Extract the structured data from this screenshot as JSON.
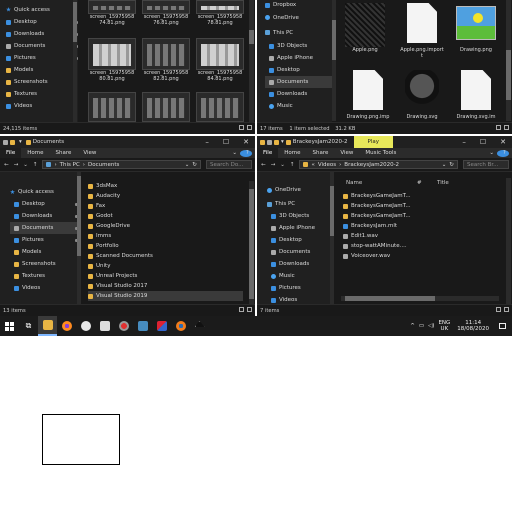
{
  "top_left": {
    "nav": [
      "Quick access",
      "Desktop",
      "Downloads",
      "Documents",
      "Pictures",
      "Models",
      "Screenshots",
      "Textures",
      "Videos"
    ],
    "thumbs": [
      [
        "screen_15975958",
        "74.81.png"
      ],
      [
        "screen_15975958",
        "76.81.png"
      ],
      [
        "screen_15975958",
        "78.81.png"
      ],
      [
        "screen_15975958",
        "80.81.png"
      ],
      [
        "screen_15975958",
        "82.81.png"
      ],
      [
        "screen_15975958",
        "84.81.png"
      ]
    ],
    "status": "24,115 items"
  },
  "top_right": {
    "nav": [
      "Dropbox",
      "OneDrive",
      "This PC",
      "3D Objects",
      "Apple iPhone",
      "Desktop",
      "Documents",
      "Downloads",
      "Music"
    ],
    "files": [
      "",
      "",
      "",
      "Apple.png",
      "Apple.png.import",
      "Drawing.png",
      "Drawing.png.imp",
      "Drawing.svg",
      "Drawing.svg.im"
    ],
    "status": "17 items",
    "status_sel": "1 item selected",
    "status_size": "31.2 KB"
  },
  "bottom_left": {
    "title": "Documents",
    "ribbon": [
      "File",
      "Home",
      "Share",
      "View"
    ],
    "path": [
      "This PC",
      "Documents"
    ],
    "search": "Search Do...",
    "nav": [
      "Quick access",
      "Desktop",
      "Downloads",
      "Documents",
      "Pictures",
      "Models",
      "Screenshots",
      "Textures",
      "Videos"
    ],
    "folders": [
      "3dsMax",
      "Audacity",
      "Fax",
      "Godot",
      "GoogleDrive",
      "Imms",
      "Portfolio",
      "Scanned Documents",
      "Unity",
      "Unreal Projects",
      "Visual Studio 2017",
      "Visual Studio 2019"
    ],
    "status": "13 items"
  },
  "bottom_right": {
    "title": "BrackeysJam2020-2",
    "play_tab": "Play",
    "ribbon": [
      "File",
      "Home",
      "Share",
      "View"
    ],
    "music_tools": "Music Tools",
    "path": [
      "«",
      "Videos",
      "BrackeysJam2020-2"
    ],
    "search": "Search Br...",
    "nav": [
      "OneDrive",
      "This PC",
      "3D Objects",
      "Apple iPhone",
      "Desktop",
      "Documents",
      "Downloads",
      "Music",
      "Pictures",
      "Videos"
    ],
    "columns": [
      "Name",
      "#",
      "Title"
    ],
    "files": [
      "BrackeysGameJamT...",
      "BrackeysGameJamT...",
      "BrackeysGameJamT...",
      "BrackeysJam.mlt",
      "Edit1.wav",
      "stop-wattAMinute....",
      "Voiceover.wav"
    ],
    "status": "7 items"
  },
  "taskbar": {
    "lang": "ENG",
    "region": "UK",
    "time": "11:14",
    "date": "18/08/2020",
    "tray": "^"
  },
  "colors": {
    "accent": "#3b8fe0",
    "folder": "#e8b544",
    "play": "#e8e85a"
  }
}
